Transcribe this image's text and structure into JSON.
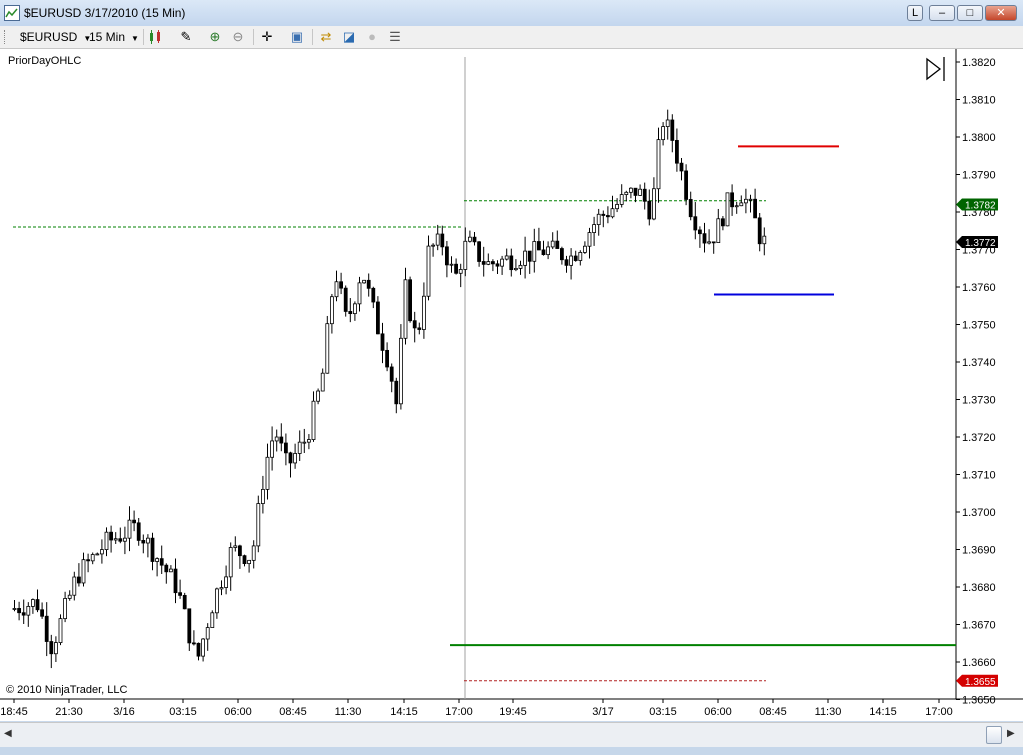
{
  "window": {
    "title": "$EURUSD  3/17/2010 (15 Min)",
    "btn_l": "L",
    "btn_min": "–",
    "btn_max": "□",
    "btn_close": "✕"
  },
  "toolbar": {
    "instrument": "$EURUSD",
    "interval": "15 Min",
    "icons": [
      "candlestick-icon",
      "pencil-icon",
      "zoom-in-icon",
      "zoom-out-icon",
      "crosshair-icon",
      "properties-icon",
      "strategy-icon",
      "chart-trader-icon",
      "disabled-circle-icon",
      "data-box-icon"
    ]
  },
  "chart": {
    "indicator_label": "PriorDayOHLC",
    "copyright": "© 2010 NinjaTrader, LLC",
    "scroll_end_icon": "scroll-to-end-icon",
    "price_axis": [
      "1.3820",
      "1.3810",
      "1.3800",
      "1.3790",
      "1.3780",
      "1.3770",
      "1.3760",
      "1.3750",
      "1.3740",
      "1.3730",
      "1.3720",
      "1.3710",
      "1.3700",
      "1.3690",
      "1.3680",
      "1.3670",
      "1.3660",
      "1.3650"
    ],
    "time_axis": [
      "18:45",
      "21:30",
      "3/16",
      "03:15",
      "06:00",
      "08:45",
      "11:30",
      "14:15",
      "17:00",
      "19:45",
      "3/17",
      "03:15",
      "06:00",
      "08:45",
      "11:30",
      "14:15",
      "17:00"
    ],
    "markers": [
      {
        "label": "1.3782",
        "color": "#006400"
      },
      {
        "label": "1.3772",
        "color": "#000000"
      },
      {
        "label": "1.3655",
        "color": "#d40000"
      }
    ],
    "colors": {
      "up": "#ffffff",
      "down": "#000000",
      "prior_high": "#e00000",
      "prior_low": "#0000dd",
      "prior_close": "#008000",
      "prior_open": "#b22222"
    }
  }
}
